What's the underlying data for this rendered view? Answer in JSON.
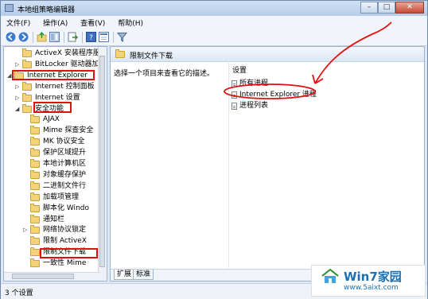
{
  "window": {
    "title": "本地组策略编辑器",
    "buttons": {
      "minimize": "–",
      "maximize": "□",
      "close": "✕"
    }
  },
  "menu": [
    "文件(F)",
    "操作(A)",
    "查看(V)",
    "帮助(H)"
  ],
  "toolbar": {
    "icons": [
      "back-icon",
      "forward-icon",
      "up-folder-icon",
      "show-hide-tree-icon",
      "export-icon",
      "help-icon",
      "properties-icon",
      "filter-icon"
    ]
  },
  "tree": {
    "items": [
      {
        "label": "ActiveX 安装程序服务",
        "expander": "",
        "depth": 2
      },
      {
        "label": "BitLocker 驱动器加密",
        "expander": "▷",
        "depth": 2
      },
      {
        "label": "Internet Explorer",
        "expander": "◢",
        "depth": 1
      },
      {
        "label": "Internet 控制面板",
        "expander": "▷",
        "depth": 2
      },
      {
        "label": "Internet 设置",
        "expander": "▷",
        "depth": 2
      },
      {
        "label": "安全功能",
        "expander": "◢",
        "depth": 2
      },
      {
        "label": "AJAX",
        "expander": "",
        "depth": 3
      },
      {
        "label": "Mime 探查安全",
        "expander": "",
        "depth": 3
      },
      {
        "label": "MK 协议安全",
        "expander": "",
        "depth": 3
      },
      {
        "label": "保护区域提升",
        "expander": "",
        "depth": 3
      },
      {
        "label": "本地计算机区",
        "expander": "",
        "depth": 3
      },
      {
        "label": "对象缓存保护",
        "expander": "",
        "depth": 3
      },
      {
        "label": "二进制文件行",
        "expander": "",
        "depth": 3
      },
      {
        "label": "加载项管理",
        "expander": "",
        "depth": 3
      },
      {
        "label": "脚本化 Windo",
        "expander": "",
        "depth": 3
      },
      {
        "label": "通知栏",
        "expander": "",
        "depth": 3
      },
      {
        "label": "网络协议锁定",
        "expander": "▷",
        "depth": 3
      },
      {
        "label": "限制 ActiveX",
        "expander": "",
        "depth": 3
      },
      {
        "label": "限制文件下载",
        "expander": "",
        "depth": 3
      },
      {
        "label": "一致性 Mime",
        "expander": "",
        "depth": 3
      }
    ]
  },
  "right": {
    "header": "限制文件下载",
    "description": "选择一个项目来查看它的描述。",
    "column_header": "设置",
    "settings": [
      "所有进程",
      "Internet Explorer 进程",
      "进程列表"
    ],
    "tabs": [
      "扩展",
      "标准"
    ]
  },
  "status": {
    "text": "3 个设置"
  },
  "watermark": {
    "brand": "Win7家园",
    "url": "www.5aixt.com"
  },
  "colors": {
    "annotation": "#e01010",
    "brand": "#1a6fb5"
  }
}
